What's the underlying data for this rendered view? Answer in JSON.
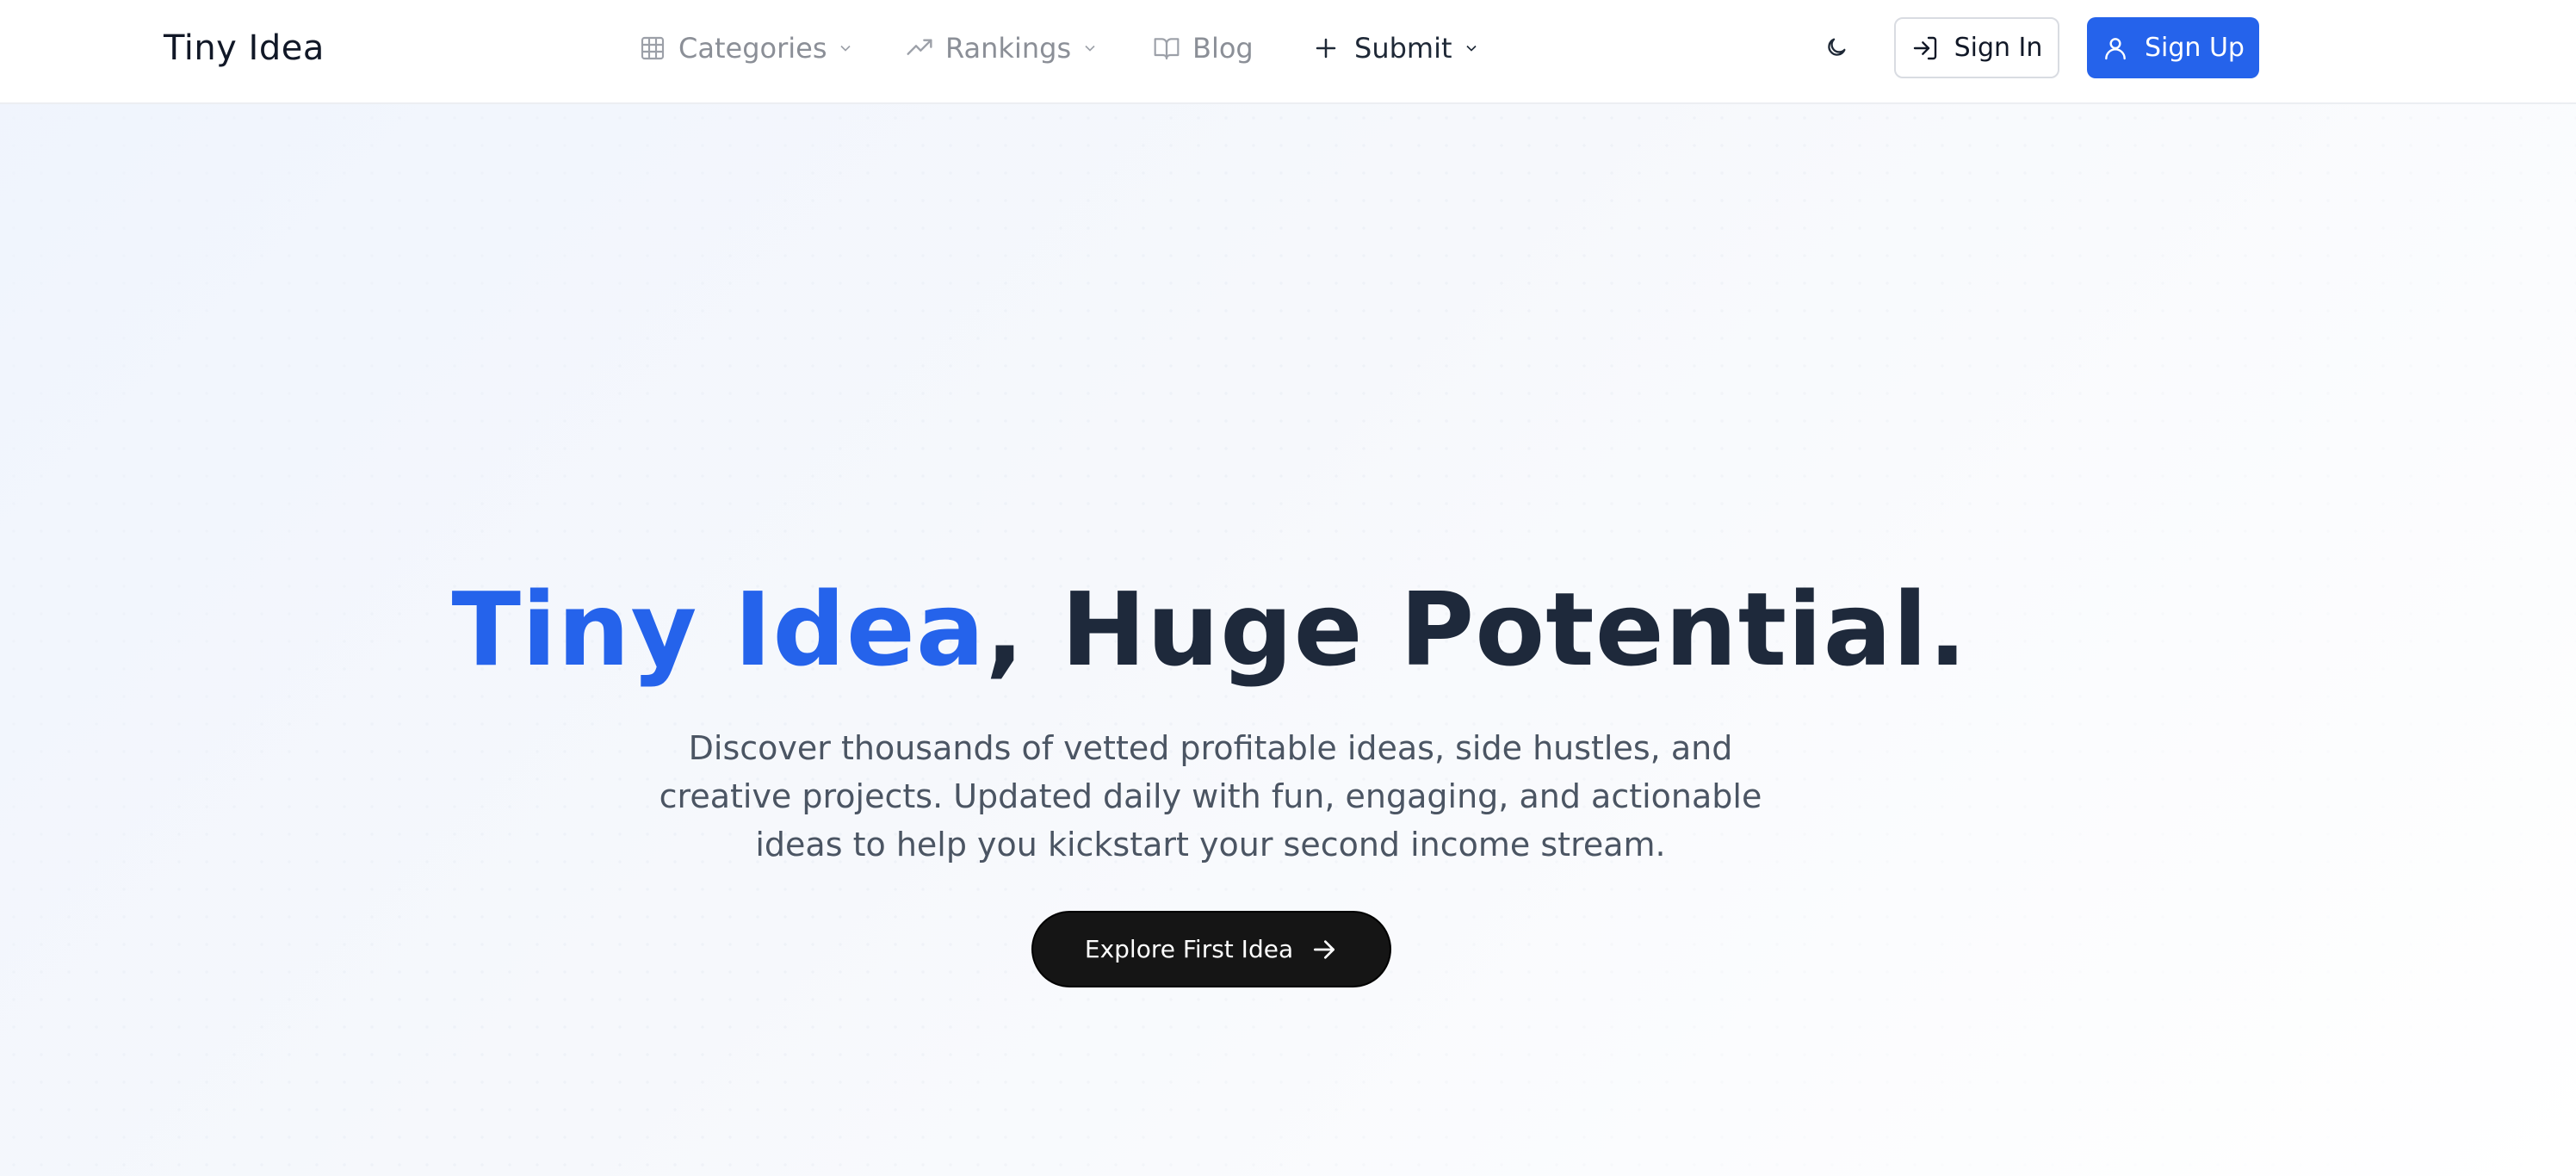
{
  "brand": {
    "name": "Tiny Idea"
  },
  "nav": {
    "categories": {
      "label": "Categories",
      "icon": "grid-icon"
    },
    "rankings": {
      "label": "Rankings",
      "icon": "trending-up-icon"
    },
    "blog": {
      "label": "Blog",
      "icon": "book-open-icon"
    },
    "submit": {
      "label": "Submit",
      "icon": "plus-icon"
    }
  },
  "header_actions": {
    "theme_toggle_icon": "moon-icon",
    "sign_in": "Sign In",
    "sign_up": "Sign Up"
  },
  "hero": {
    "headline_accent": "Tiny Idea",
    "headline_rest": ", Huge Potential.",
    "subtitle": "Discover thousands of vetted profitable ideas, side hustles, and creative projects. Updated daily with fun, engaging, and actionable ideas to help you kickstart your second income stream.",
    "cta_label": "Explore First Idea"
  },
  "colors": {
    "accent": "#2563eb",
    "headline": "#1e293b",
    "cta_background": "#151515",
    "nav_muted": "#8b8f97"
  }
}
